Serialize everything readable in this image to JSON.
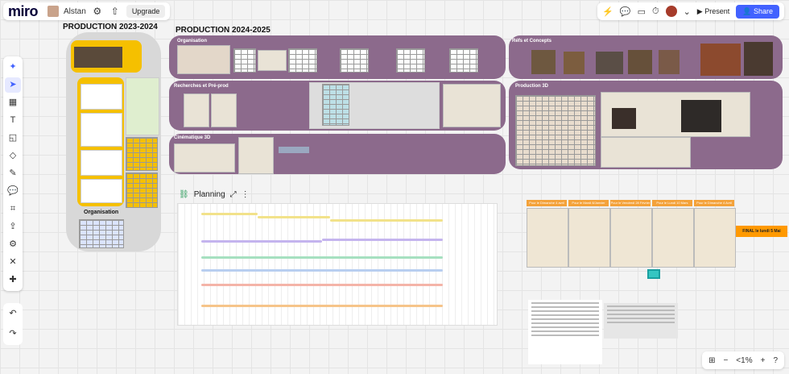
{
  "app": {
    "logo": "miro",
    "board_name": "Alstan",
    "upgrade_label": "Upgrade"
  },
  "header_right": {
    "present_label": "Present",
    "share_label": "Share"
  },
  "zoom": {
    "level": "<1%"
  },
  "frames": {
    "prod_2023": "PRODUCTION 2023-2024",
    "prod_2024": "PRODUCTION 2024-2025",
    "organisation_left": "Organisation",
    "organisation": "Organisation",
    "refs": "Réfs et Concepts",
    "recherches": "Recherches et Pré-prod",
    "production3d": "Production 3D",
    "cinematique": "Cinématique 3D"
  },
  "planning": {
    "label": "Planning"
  },
  "schedule_heads": [
    "Pour le Dimanche 4 avril",
    "Pour le Mardi 8/Janvier",
    "Pour le Vendredi 28 Février",
    "Pour le Lundi 10 Mars",
    "Pour le Dimanche 4 Avril"
  ],
  "final_note": "FINAL le lundi 5 Mai",
  "icons": [
    "miro-logo",
    "upload-icon",
    "select-icon",
    "table-icon",
    "text-icon",
    "sticky-icon",
    "shapes-icon",
    "pen-icon",
    "comment-icon",
    "frame-icon",
    "upload-tool-icon",
    "mindmap-icon",
    "connector-icon",
    "more-icon",
    "undo-icon",
    "redo-icon"
  ],
  "colors": {
    "purple_frame": "#8c6a8c",
    "yellow": "#f5c000",
    "share": "#4262ff",
    "orange": "#f4a23a"
  }
}
